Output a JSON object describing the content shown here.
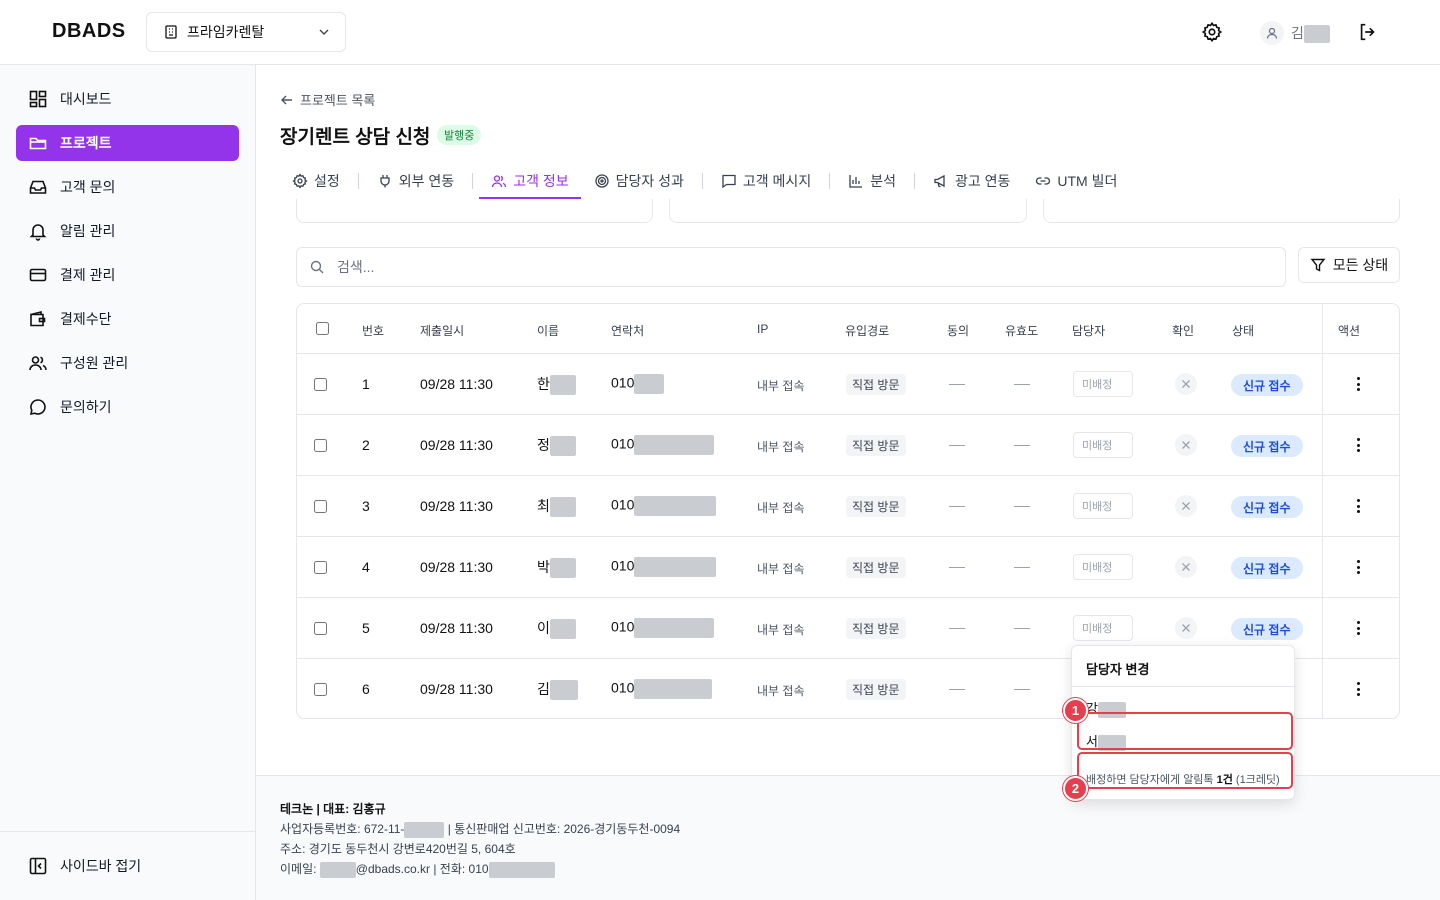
{
  "header": {
    "logo": "DBADS",
    "org_name": "프라임카렌탈",
    "user_name_prefix": "김"
  },
  "sidebar": {
    "items": [
      {
        "label": "대시보드",
        "icon": "dashboard-icon"
      },
      {
        "label": "프로젝트",
        "icon": "folder-icon",
        "active": true
      },
      {
        "label": "고객 문의",
        "icon": "inbox-icon"
      },
      {
        "label": "알림 관리",
        "icon": "bell-icon"
      },
      {
        "label": "결제 관리",
        "icon": "credit-card-icon"
      },
      {
        "label": "결제수단",
        "icon": "wallet-icon"
      },
      {
        "label": "구성원 관리",
        "icon": "users-icon"
      },
      {
        "label": "문의하기",
        "icon": "chat-icon"
      }
    ],
    "collapse_label": "사이드바 접기"
  },
  "page": {
    "back_label": "프로젝트 목록",
    "title": "장기렌트 상담 신청",
    "status_badge": "발행중"
  },
  "tabs": [
    {
      "label": "설정",
      "icon": "gear-icon"
    },
    {
      "label": "외부 연동",
      "icon": "plug-icon"
    },
    {
      "label": "고객 정보",
      "icon": "users-icon",
      "active": true
    },
    {
      "label": "담당자 성과",
      "icon": "target-icon"
    },
    {
      "label": "고객 메시지",
      "icon": "message-icon"
    },
    {
      "label": "분석",
      "icon": "bar-chart-icon"
    },
    {
      "label": "광고 연동",
      "icon": "megaphone-icon"
    },
    {
      "label": "UTM 빌더",
      "icon": "link-icon"
    }
  ],
  "search": {
    "placeholder": "검색...",
    "filter_label": "모든 상태"
  },
  "table": {
    "columns": [
      "번호",
      "제출일시",
      "이름",
      "연락처",
      "IP",
      "유입경로",
      "동의",
      "유효도",
      "담당자",
      "확인",
      "상태",
      "액션"
    ],
    "rows": [
      {
        "no": "1",
        "date": "09/28 11:30",
        "name": "한",
        "phone": "010",
        "ip": "내부 접속",
        "source": "직접 방문",
        "assignee": "미배정",
        "status": "신규 접수"
      },
      {
        "no": "2",
        "date": "09/28 11:30",
        "name": "정",
        "phone": "010",
        "ip": "내부 접속",
        "source": "직접 방문",
        "assignee": "미배정",
        "status": "신규 접수"
      },
      {
        "no": "3",
        "date": "09/28 11:30",
        "name": "최",
        "phone": "010",
        "ip": "내부 접속",
        "source": "직접 방문",
        "assignee": "미배정",
        "status": "신규 접수"
      },
      {
        "no": "4",
        "date": "09/28 11:30",
        "name": "박",
        "phone": "010",
        "ip": "내부 접속",
        "source": "직접 방문",
        "assignee": "미배정",
        "status": "신규 접수"
      },
      {
        "no": "5",
        "date": "09/28 11:30",
        "name": "이",
        "phone": "010",
        "ip": "내부 접속",
        "source": "직접 방문",
        "assignee": "미배정",
        "status": "신규 접수"
      },
      {
        "no": "6",
        "date": "09/28 11:30",
        "name": "김",
        "phone": "010",
        "ip": "내부 접속",
        "source": "직접 방문",
        "assignee": "",
        "status": ""
      }
    ]
  },
  "dropdown": {
    "title": "담당자 변경",
    "options": [
      "강",
      "서"
    ],
    "note_prefix": "배정하면 담당자에게 알림톡 ",
    "note_count": "1건",
    "note_suffix": " (1크레딧)"
  },
  "markers": [
    "1",
    "2"
  ],
  "footer": {
    "company": "테크논 | 대표: 김홍규",
    "biz_prefix": "사업자등록번호: 672-11-",
    "biz_suffix": " | 통신판매업 신고번호: 2026-경기동두천-0094",
    "address": "주소: 경기도 동두천시 강변로420번길 5, 604호",
    "email_prefix": "이메일: ",
    "email_suffix": "@dbads.co.kr | 전화: 010"
  }
}
